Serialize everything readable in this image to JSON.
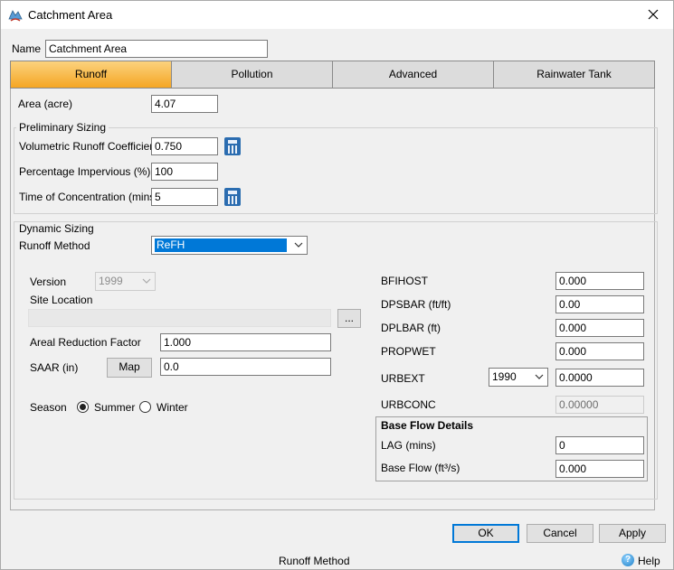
{
  "window": {
    "title": "Catchment Area",
    "close_icon": "close-icon",
    "app_icon": "catchment-icon"
  },
  "name": {
    "label": "Name",
    "value": "Catchment Area"
  },
  "tabs": [
    {
      "label": "Runoff",
      "active": true
    },
    {
      "label": "Pollution",
      "active": false
    },
    {
      "label": "Advanced",
      "active": false
    },
    {
      "label": "Rainwater Tank",
      "active": false
    }
  ],
  "area": {
    "label": "Area (acre)",
    "value": "4.07"
  },
  "preliminary": {
    "title": "Preliminary Sizing",
    "runoff_coeff": {
      "label": "Volumetric Runoff Coefficient",
      "value": "0.750"
    },
    "impervious": {
      "label": "Percentage Impervious (%)",
      "value": "100"
    },
    "toc": {
      "label": "Time of Concentration (mins)",
      "value": "5"
    }
  },
  "dynamic": {
    "title": "Dynamic Sizing",
    "method_label": "Runoff Method",
    "method_value": "ReFH",
    "version_label": "Version",
    "version_value": "1999",
    "site_location_label": "Site Location",
    "site_location_value": "",
    "browse_label": "...",
    "arf_label": "Areal Reduction Factor",
    "arf_value": "1.000",
    "saar_label": "SAAR (in)",
    "map_label": "Map",
    "saar_value": "0.0",
    "season_label": "Season",
    "summer_label": "Summer",
    "winter_label": "Winter",
    "season_selected": "Summer",
    "bfihost_label": "BFIHOST",
    "bfihost_value": "0.000",
    "dpsbar_label": "DPSBAR (ft/ft)",
    "dpsbar_value": "0.00",
    "dplbar_label": "DPLBAR (ft)",
    "dplbar_value": "0.000",
    "propwet_label": "PROPWET",
    "propwet_value": "0.000",
    "urbext_label": "URBEXT",
    "urbext_year": "1990",
    "urbext_value": "0.0000",
    "urbconc_label": "URBCONC",
    "urbconc_value": "0.00000",
    "baseflow": {
      "title": "Base Flow Details",
      "lag_label": "LAG (mins)",
      "lag_value": "0",
      "flow_label": "Base Flow (ft³/s)",
      "flow_value": "0.000"
    }
  },
  "buttons": {
    "ok": "OK",
    "cancel": "Cancel",
    "apply": "Apply"
  },
  "status": {
    "text": "Runoff Method",
    "help": "Help",
    "help_icon": "help-icon"
  },
  "colors": {
    "tab_active": "#f5a623",
    "selection": "#0078d7",
    "calc_icon": "#2b6cb0"
  }
}
